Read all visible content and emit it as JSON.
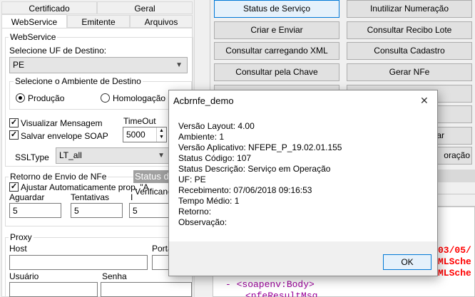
{
  "tabs": {
    "row1": [
      "Certificado",
      "Geral",
      ""
    ],
    "row2": [
      "WebService",
      "Emitente",
      "Arquivos"
    ]
  },
  "webservice": {
    "group_title": "WebService",
    "uf_label": "Selecione UF de Destino:",
    "uf_value": "PE",
    "ambiente_title": "Selecione o Ambiente de Destino",
    "producao": "Produção",
    "homologacao": "Homologação",
    "visualizar": "Visualizar Mensagem",
    "salvar": "Salvar envelope SOAP",
    "timeout_label": "TimeOut",
    "timeout_value": "5000",
    "ssltype_label": "SSLType",
    "ssltype_value": "LT_all"
  },
  "retorno": {
    "title": "Retorno de Envio de NFe",
    "ajustar": "Ajustar Automaticamente prop. \"A",
    "aguardar_label": "Aguardar",
    "aguardar_value": "5",
    "tentativas_label": "Tentativas",
    "tentativas_value": "5",
    "intervalo_label": "I",
    "intervalo_value": "5",
    "status_overlay": "Status do",
    "verificando": "Verificando"
  },
  "proxy": {
    "title": "Proxy",
    "host": "Host",
    "porta": "Porta",
    "usuario": "Usuário",
    "senha": "Senha"
  },
  "buttons": {
    "status_servico": "Status de Serviço",
    "inutilizar": "Inutilizar Numeração",
    "criar_enviar": "Criar e Enviar",
    "consultar_recibo": "Consultar Recibo Lote",
    "consultar_xml": "Consultar carregando XML",
    "consulta_cadastro": "Consulta Cadastro",
    "consultar_chave": "Consultar pela Chave",
    "gerar_nfe": "Gerar NFe",
    "partial_iar": "iar",
    "partial_oracao": "oração"
  },
  "xml_view": {
    "fragment_date": "03/05/",
    "fragment_mlsche1": "MLSche",
    "fragment_mlsche2": "MLSche",
    "soap_body": "- <soapenv:Body>",
    "nfe_result": "<nfeResultMsg"
  },
  "dialog": {
    "title": "Acbrnfe_demo",
    "close_glyph": "✕",
    "lines": [
      "Versão Layout: 4.00",
      "Ambiente: 1",
      "Versão Aplicativo: NFEPE_P_19.02.01.155",
      "Status Código: 107",
      "Status Descrição: Serviço em Operação",
      "UF: PE",
      "Recebimento: 07/06/2018 09:16:53",
      "Tempo Médio: 1",
      "Retorno:",
      "Observação:"
    ],
    "ok_label": "OK"
  },
  "colors": {
    "xml_red": "#ff0000",
    "xml_blue": "#0000ff",
    "xml_magenta": "#990099",
    "focus_blue": "#0078d7"
  }
}
